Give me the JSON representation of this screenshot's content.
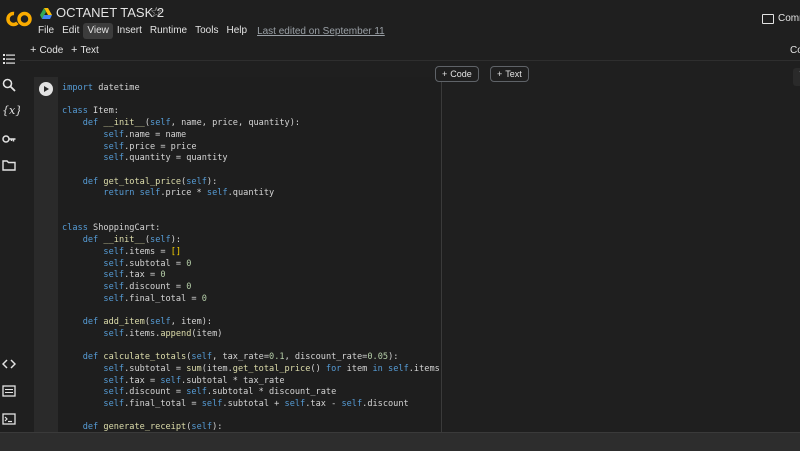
{
  "header": {
    "title": "OCTANET TASK 2",
    "star_icon": "star-outline-icon",
    "comment_label": "Comment",
    "last_edited": "Last edited on September 11"
  },
  "menu": [
    "File",
    "Edit",
    "View",
    "Insert",
    "Runtime",
    "Tools",
    "Help"
  ],
  "menu_active": "View",
  "toolbar": {
    "add_code_label": "Code",
    "add_text_label": "Text",
    "right_label": "Co"
  },
  "cell": {
    "float_code_label": "Code",
    "float_text_label": "Text",
    "tools": "↑ ↓"
  },
  "code_lines": [
    "import datetime",
    "",
    "class Item:",
    "    def __init__(self, name, price, quantity):",
    "        self.name = name",
    "        self.price = price",
    "        self.quantity = quantity",
    "",
    "    def get_total_price(self):",
    "        return self.price * self.quantity",
    "",
    "",
    "class ShoppingCart:",
    "    def __init__(self):",
    "        self.items = []",
    "        self.subtotal = 0",
    "        self.tax = 0",
    "        self.discount = 0",
    "        self.final_total = 0",
    "",
    "    def add_item(self, item):",
    "        self.items.append(item)",
    "",
    "    def calculate_totals(self, tax_rate=0.1, discount_rate=0.05):",
    "        self.subtotal = sum(item.get_total_price() for item in self.items)",
    "        self.tax = self.subtotal * tax_rate",
    "        self.discount = self.subtotal * discount_rate",
    "        self.final_total = self.subtotal + self.tax - self.discount",
    "",
    "    def generate_receipt(self):"
  ],
  "sidebar_icons": [
    "toc-icon",
    "search-icon",
    "variables-icon",
    "secrets-key-icon",
    "files-folder-icon",
    "code-snippets-icon",
    "command-palette-icon",
    "terminal-icon"
  ],
  "colors": {
    "background": "#1f1f1f",
    "logo_orange": "#f9ab00",
    "keyword": "#569cd6",
    "function": "#dcdcaa"
  }
}
